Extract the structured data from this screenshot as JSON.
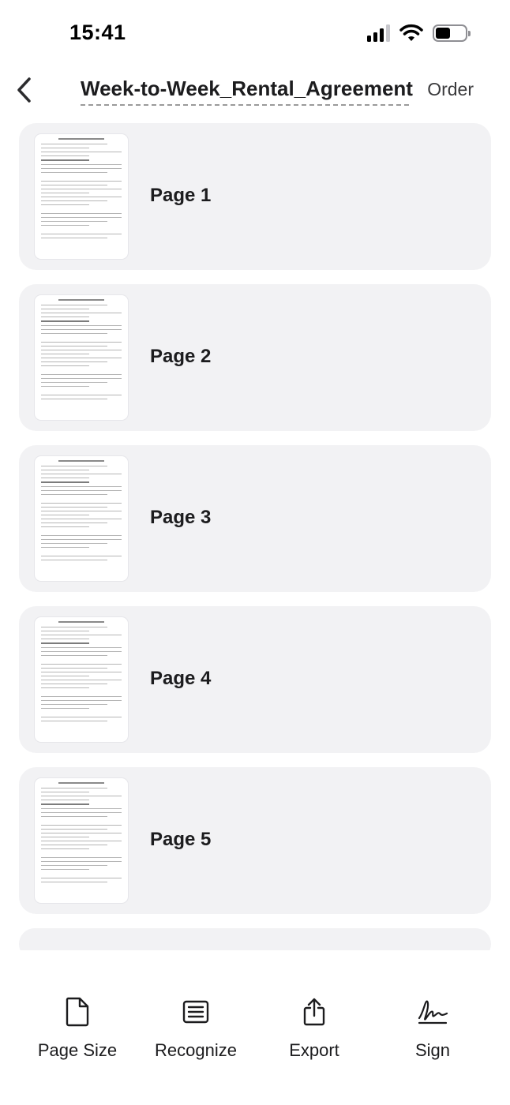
{
  "status_bar": {
    "time": "15:41"
  },
  "nav": {
    "title": "Week-to-Week_Rental_Agreement",
    "order_label": "Order"
  },
  "pages": [
    {
      "label": "Page 1"
    },
    {
      "label": "Page 2"
    },
    {
      "label": "Page 3"
    },
    {
      "label": "Page 4"
    },
    {
      "label": "Page 5"
    }
  ],
  "toolbar": {
    "page_size_label": "Page Size",
    "recognize_label": "Recognize",
    "export_label": "Export",
    "sign_label": "Sign"
  },
  "icons": {
    "back": "chevron-left-icon",
    "page_size": "document-icon",
    "recognize": "text-lines-icon",
    "export": "share-icon",
    "sign": "signature-icon"
  },
  "colors": {
    "card_background": "#f2f2f4",
    "text": "#1c1c1e"
  }
}
